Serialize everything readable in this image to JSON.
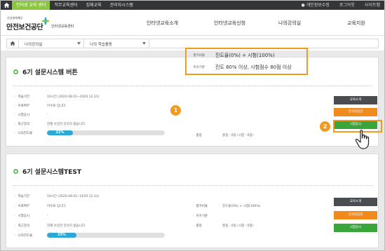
{
  "topbar": {
    "tabs": [
      "인터넷 교육 센터",
      "직무교육센터",
      "집체교육",
      "관리자시스템"
    ],
    "active_tab_index": 0,
    "join": "개인정보수정",
    "logout": "로그아웃",
    "sitemap": "사이트맵"
  },
  "header": {
    "brand_small": "산업재해예방",
    "brand_main": "안전보건공단",
    "brand_sub": "인터넷교육센터",
    "nav": [
      "인터넷교육소개",
      "인터넷교육신청",
      "나의강의실",
      "교육지원"
    ]
  },
  "breadcrumb": {
    "level1": "나의강의실",
    "level2": "나의 학습활동"
  },
  "courses": [
    {
      "title": "6기 설문시스템 버튼",
      "fields": [
        {
          "label": "학습기간",
          "value": "10시간 (2020.08.01~2020.12.31)"
        },
        {
          "label": "수료여부",
          "value": "미수료 입니다."
        },
        {
          "label": "시험응시",
          "value": "-"
        },
        {
          "label": "최근강의",
          "value": "현재 수강한 강의가 없습니다."
        },
        {
          "label": "나의진도율",
          "value": ""
        }
      ],
      "progress": 22,
      "progress_label": "22%",
      "right": [
        {
          "label": "평가비율",
          "value": "진도율(0%) + 시험(100%)"
        },
        {
          "label": "이수기준",
          "value": "진도 80% 이상, 시험점수 80점 이상"
        },
        {
          "label": "총점",
          "value": "총점 : 0점 (시험 : 0점)"
        }
      ],
      "buttons": {
        "intro": "교육소개",
        "study": "강의실입장",
        "exam": "시험응시"
      }
    },
    {
      "title": "6기 설문시스템TEST",
      "fields": [
        {
          "label": "학습기간",
          "value": "10시간 (2020.08.01~2020.12.31)"
        },
        {
          "label": "수료여부",
          "value": "미수료 입니다."
        },
        {
          "label": "시험응시",
          "value": "-"
        },
        {
          "label": "최근강의",
          "value": "현재 수강한 강의가 없습니다."
        },
        {
          "label": "나의진도율",
          "value": ""
        }
      ],
      "progress": 25,
      "progress_label": "25%",
      "right": [
        {
          "label": "평가비율",
          "value": "진도율(0%) + 시험(100%)"
        },
        {
          "label": "이수기준",
          "value": ""
        },
        {
          "label": "총점",
          "value": "총점 : 0점 (시험 : 0점)"
        }
      ],
      "buttons": {
        "intro": "교육소개",
        "study": "강의실입장",
        "exam": "시험응시"
      }
    }
  ],
  "annotations": {
    "badge1": "1",
    "badge2": "2"
  },
  "colors": {
    "accent_green": "#8cc63f",
    "highlight": "#f29a1d",
    "progress": "#2aa8d6"
  }
}
